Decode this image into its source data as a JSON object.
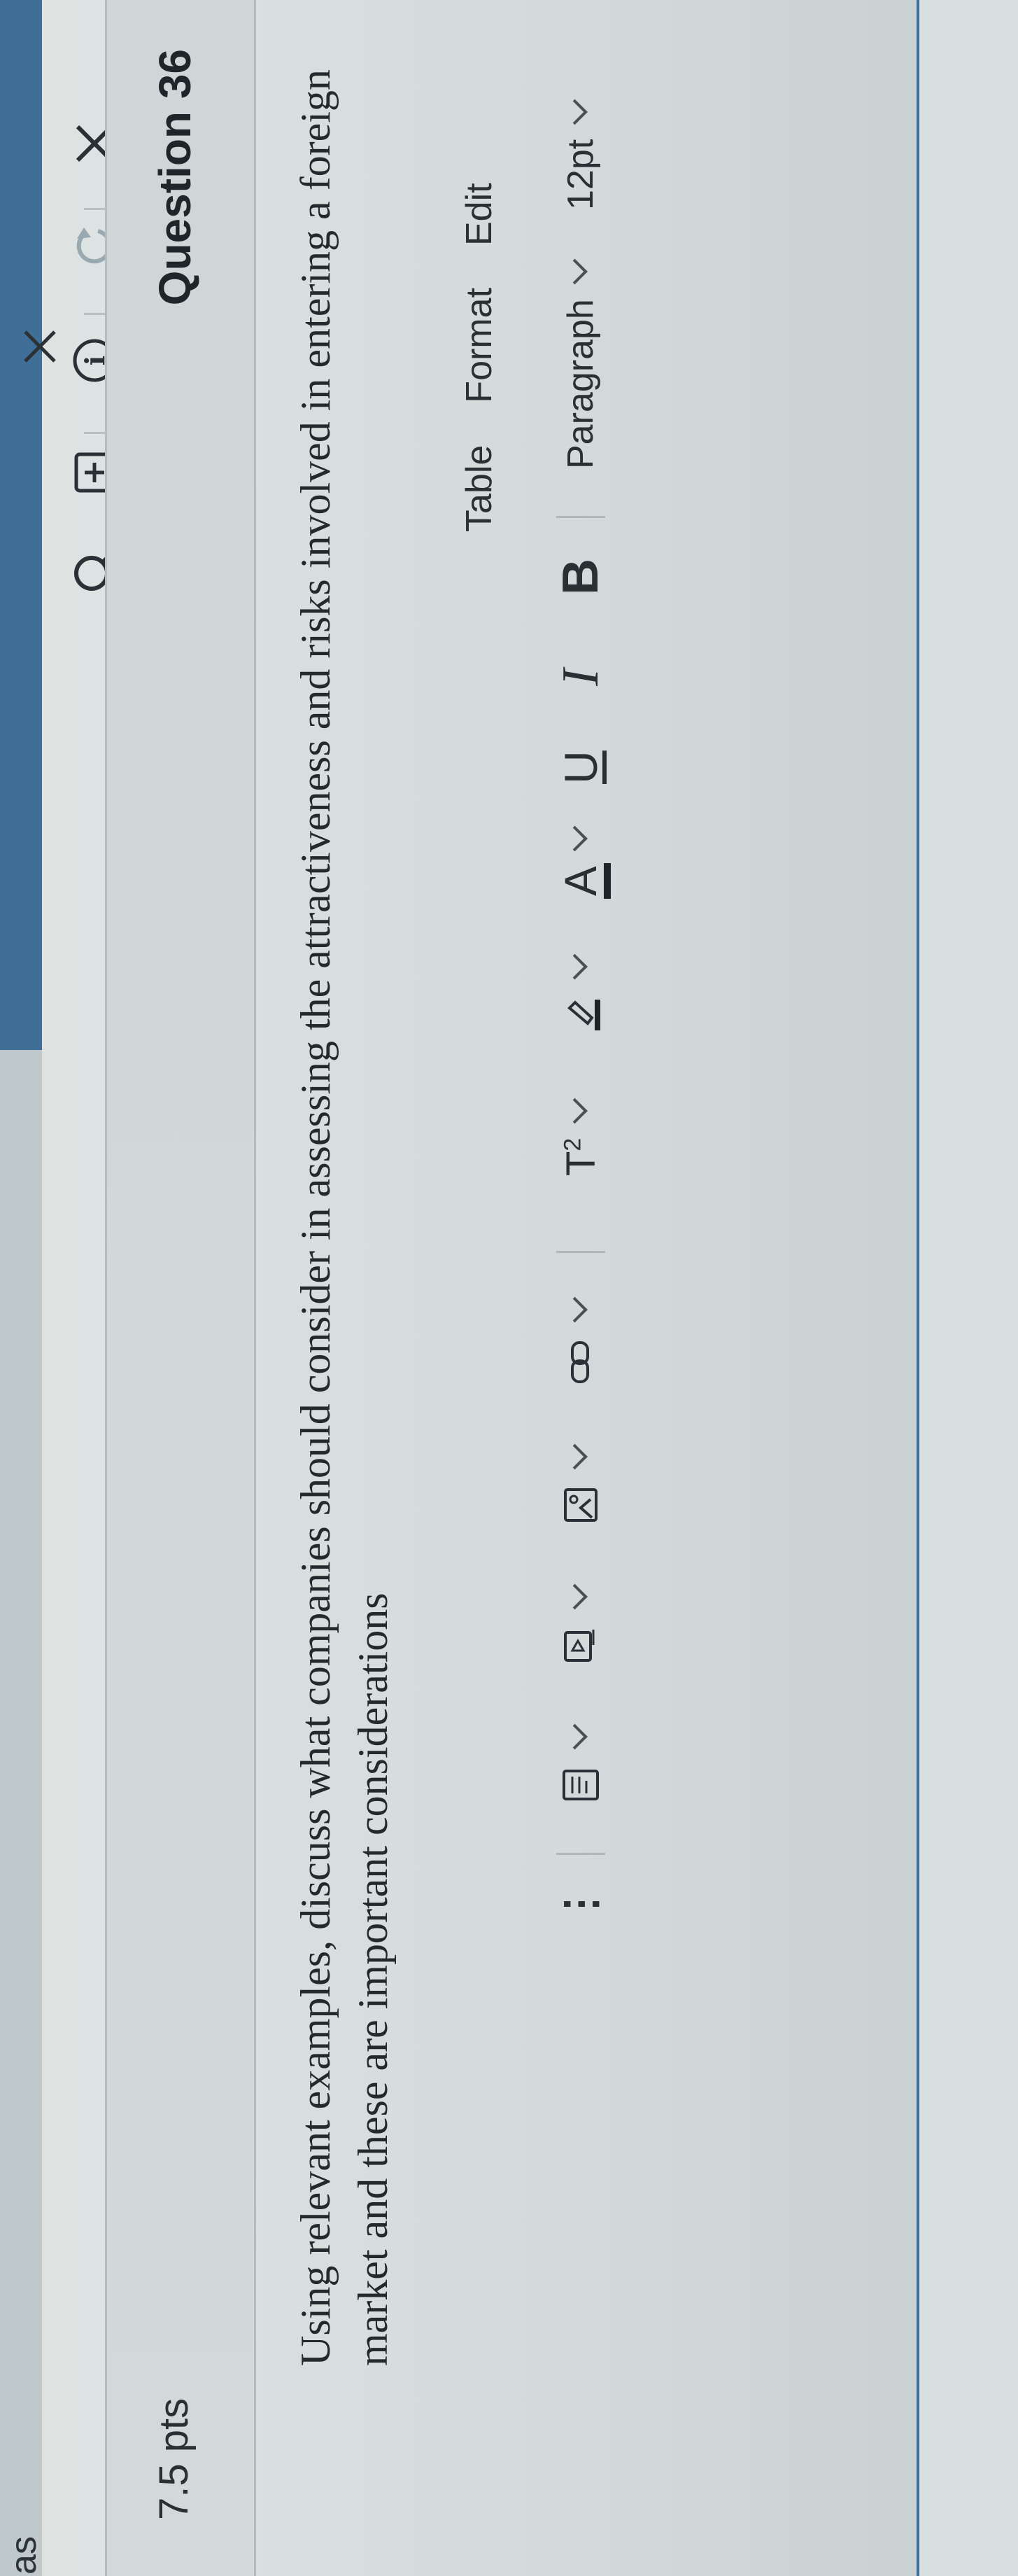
{
  "app": {
    "tab_fragment": "as"
  },
  "top_toolbar": {
    "close_label": "×",
    "redo_label": "↻",
    "info_label": "i",
    "add_label": "+",
    "search_label": "⌕"
  },
  "question": {
    "title": "Question 36",
    "points": "7.5 pts",
    "text": "Using relevant examples, discuss what companies should consider in assessing the attractiveness and risks involved in entering a foreign market and these are important considerations"
  },
  "editor": {
    "menu": [
      "Edit",
      "Format",
      "Table"
    ],
    "font_size": "12pt",
    "block_format": "Paragraph",
    "bold_label": "B",
    "italic_label": "I",
    "underline_label": "U",
    "text_color_label": "A",
    "superscript_label": "T",
    "superscript_exp": "2"
  },
  "colors": {
    "accent_blue": "#3f6f97",
    "text": "#24292d"
  }
}
